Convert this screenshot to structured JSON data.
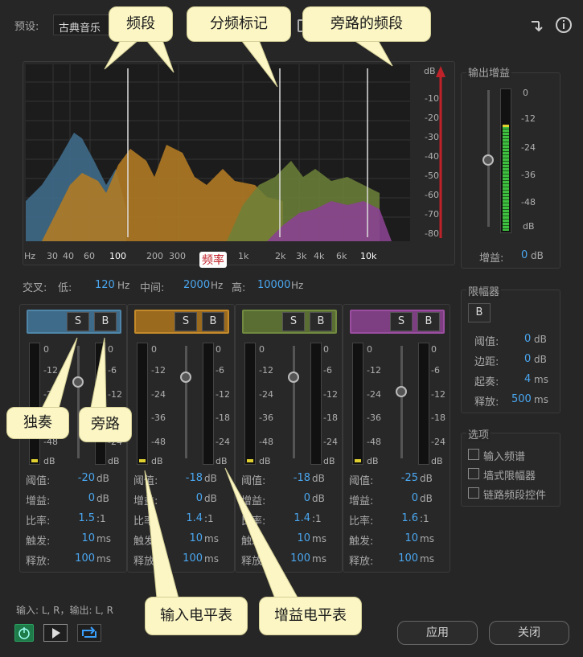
{
  "preset": {
    "label": "预设:",
    "value": "古典音乐"
  },
  "graph": {
    "db_unit": "dB",
    "db_ticks": [
      "-10",
      "-20",
      "-30",
      "-40",
      "-50",
      "-60",
      "-70",
      "-80"
    ],
    "freq_ticks": [
      "Hz",
      "30",
      "40",
      "60",
      "100",
      "200",
      "300",
      "1k",
      "2k",
      "3k",
      "4k",
      "6k",
      "10k"
    ],
    "freq_label": "频率"
  },
  "crossover": {
    "label": "交叉:",
    "low_label": "低:",
    "low_value": "120",
    "mid_label": "中间:",
    "mid_value": "2000",
    "high_label": "高:",
    "high_value": "10000",
    "unit": "Hz"
  },
  "bands": [
    {
      "color": "#3f6b8a",
      "border": "#4f86a8",
      "solo": "S",
      "bypass": "B",
      "threshold": "-20",
      "gain": "0",
      "ratio": "1.5",
      "ratio_suffix": ":1",
      "attack": "10",
      "release": "100"
    },
    {
      "color": "#9a6a1e",
      "border": "#c48a2a",
      "solo": "S",
      "bypass": "B",
      "threshold": "-18",
      "gain": "0",
      "ratio": "1.4",
      "ratio_suffix": ":1",
      "attack": "10",
      "release": "100"
    },
    {
      "color": "#5a6e34",
      "border": "#718a40",
      "solo": "S",
      "bypass": "B",
      "threshold": "-18",
      "gain": "0",
      "ratio": "1.4",
      "ratio_suffix": ":1",
      "attack": "10",
      "release": "100"
    },
    {
      "color": "#7e3e82",
      "border": "#9b4ea0",
      "solo": "S",
      "bypass": "B",
      "threshold": "-25",
      "gain": "0",
      "ratio": "1.6",
      "ratio_suffix": ":1",
      "attack": "10",
      "release": "100"
    }
  ],
  "band_labels": {
    "threshold": "阈值:",
    "gain": "增益:",
    "ratio": "比率:",
    "attack": "触发:",
    "release": "释放:",
    "db": "dB",
    "ms": "ms"
  },
  "band_meter_ticks": [
    "0",
    "-12",
    "-24",
    "-36",
    "-48",
    "dB"
  ],
  "band_gain_ticks": [
    "0",
    "-6",
    "-12",
    "-18",
    "-24",
    "dB"
  ],
  "output": {
    "title": "输出增益",
    "ticks": [
      "0",
      "-12",
      "-24",
      "-36",
      "-48",
      "dB"
    ],
    "gain_label": "增益:",
    "gain_value": "0",
    "gain_unit": "dB"
  },
  "limiter": {
    "title": "限幅器",
    "b": "B",
    "threshold_label": "阈值:",
    "threshold": "0",
    "margin_label": "边距:",
    "margin": "0",
    "attack_label": "起奏:",
    "attack": "4",
    "release_label": "释放:",
    "release": "500",
    "db": "dB",
    "ms": "ms"
  },
  "options": {
    "title": "选项",
    "items": [
      "输入频谱",
      "墙式限幅器",
      "链路频段控件"
    ]
  },
  "io_text": "输入: L, R，输出: L, R",
  "buttons": {
    "apply": "应用",
    "close": "关闭"
  },
  "callouts": {
    "band": "频段",
    "crossover_marker": "分频标记",
    "bypassed_band": "旁路的频段",
    "solo": "独奏",
    "bypass": "旁路",
    "input_meter": "输入电平表",
    "gain_meter": "增益电平表"
  }
}
